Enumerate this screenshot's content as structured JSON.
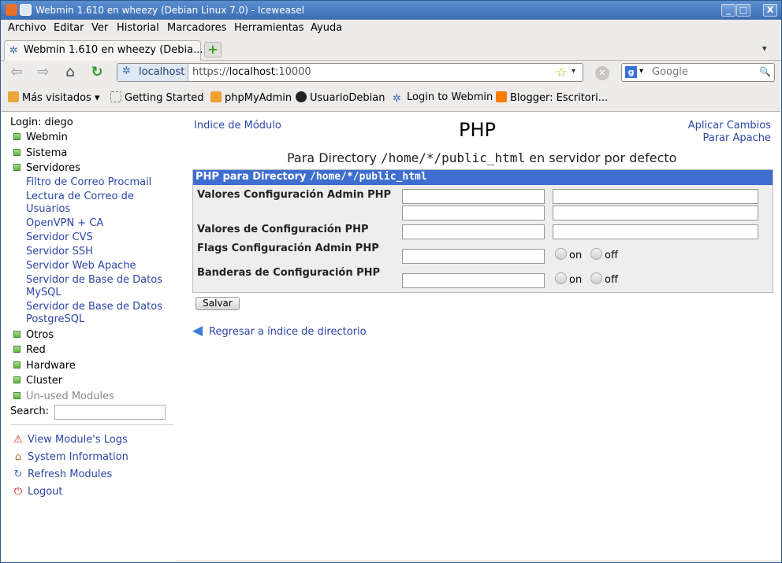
{
  "window": {
    "title": "Webmin 1.610 en wheezy (Debian Linux 7.0) - Iceweasel",
    "controls": {
      "minimize": "_",
      "maximize": "□",
      "close": "X"
    }
  },
  "menu": [
    "Archivo",
    "Editar",
    "Ver",
    "Historial",
    "Marcadores",
    "Herramientas",
    "Ayuda"
  ],
  "tab": {
    "label": "Webmin 1.610 en wheezy (Debia...",
    "new_tab": "+"
  },
  "nav": {
    "identity": "localhost",
    "url_prefix": "https://",
    "url_host": "localhost",
    "url_suffix": ":10000",
    "search_placeholder": "Google"
  },
  "bookmarks": [
    "Más visitados",
    "Getting Started",
    "phpMyAdmin",
    "UsuarioDebian",
    "Login to Webmin",
    "Blogger: Escritori..."
  ],
  "sidebar": {
    "login": "Login: diego",
    "categories": [
      "Webmin",
      "Sistema",
      "Servidores",
      "Otros",
      "Red",
      "Hardware",
      "Cluster",
      "Un-used Modules"
    ],
    "servers": [
      "Filtro de Correo Procmail",
      "Lectura de Correo de Usuarios",
      "OpenVPN + CA",
      "Servidor CVS",
      "Servidor SSH",
      "Servidor Web Apache",
      "Servidor de Base de Datos MySQL",
      "Servidor de Base de Datos PostgreSQL"
    ],
    "search_label": "Search:",
    "links": [
      "View Module's Logs",
      "System Information",
      "Refresh Modules",
      "Logout"
    ]
  },
  "main": {
    "module_index": "Indice de Módulo",
    "title": "PHP",
    "apply": "Aplicar Cambios",
    "stop": "Parar Apache",
    "subtitle_pre": "Para Directory",
    "subtitle_path": "/home/*/public_html",
    "subtitle_post": "en servidor por defecto",
    "table_header_pre": "PHP para Directory",
    "table_header_path": "/home/*/public_html",
    "rows": [
      "Valores Configuración Admin PHP",
      "Valores de Configuración PHP",
      "Flags Configuración Admin PHP",
      "Banderas de Configuración PHP"
    ],
    "on": "on",
    "off": "off",
    "save": "Salvar",
    "back": "Regresar a índice de directorio"
  }
}
